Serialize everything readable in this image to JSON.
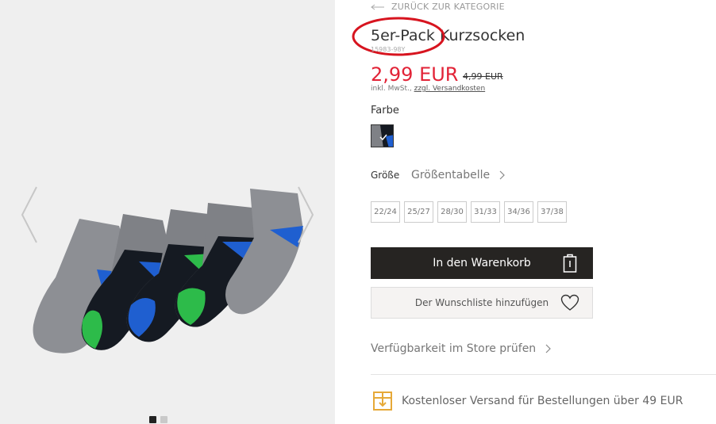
{
  "nav": {
    "back_label": "ZURÜCK ZUR KATEGORIE"
  },
  "product": {
    "title": "5er-Pack Kurzsocken",
    "sku": "15983-98Y",
    "price": "2,99 EUR",
    "old_price": "4,99 EUR",
    "tax_prefix": "inkl. MwSt., ",
    "tax_link": "zzgl. Versandkosten",
    "color_label": "Farbe",
    "size_label": "Größe",
    "size_chart_label": "Größentabelle",
    "sizes": [
      "22/24",
      "25/27",
      "28/30",
      "31/33",
      "34/36",
      "37/38"
    ]
  },
  "actions": {
    "cart_label": "In den Warenkorb",
    "wishlist_label": "Der Wunschliste hinzufügen",
    "store_label": "Verfügbarkeit im Store prüfen"
  },
  "shipping": {
    "text": "Kostenloser Versand für Bestellungen über 49 EUR"
  },
  "gallery": {
    "image_count": 2,
    "active_index": 0
  },
  "colors": {
    "price": "#e22337",
    "cart_button": "#262422",
    "accent_box": "#e6a938",
    "annotation": "#d7141f"
  },
  "icons": [
    "arrow-left-icon",
    "chevron-left-icon",
    "chevron-right-icon",
    "bag-icon",
    "heart-icon",
    "box-icon",
    "check-icon"
  ]
}
